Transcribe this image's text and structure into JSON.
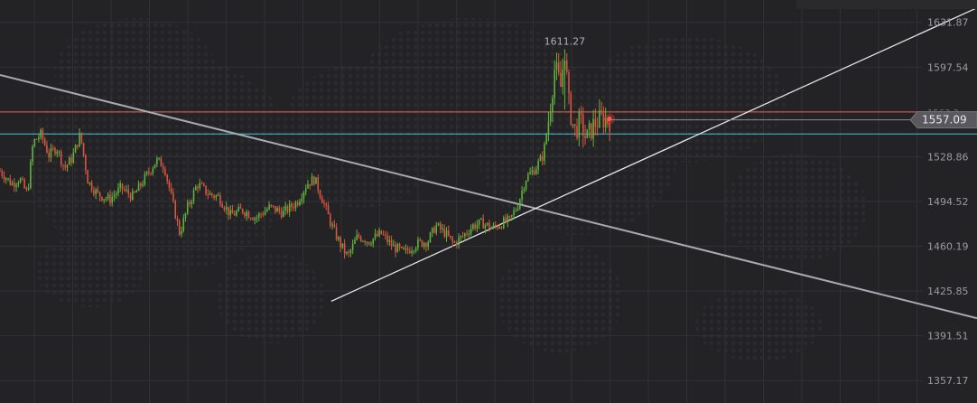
{
  "chart_data": {
    "type": "candlestick",
    "ylim": [
      1340.0,
      1649.0
    ],
    "y_ticks": [
      "1631.87",
      "1597.54",
      "1563.2",
      "1528.86",
      "1494.52",
      "1460.19",
      "1425.85",
      "1391.51",
      "1357.17"
    ],
    "last_price": "1557.09",
    "high_marker": "1611.27",
    "horizontal_levels": [
      {
        "value": 1563.2,
        "color": "#d9694f"
      },
      {
        "value": 1546.3,
        "color": "#46c2d4"
      }
    ],
    "trendlines": [
      {
        "name": "descending",
        "from": [
          0,
          1591.5
        ],
        "to": [
          1.0,
          1405.0
        ],
        "color": "#a9a9b1"
      },
      {
        "name": "ascending",
        "from": [
          0.339,
          1418.0
        ],
        "to": [
          1.0,
          1643.0
        ],
        "color": "#e6e6ea"
      }
    ],
    "up_color": "#5fb33c",
    "down_color": "#d9553f",
    "close_path": [
      [
        0.0,
        1518
      ],
      [
        0.012,
        1508
      ],
      [
        0.02,
        1512
      ],
      [
        0.028,
        1500
      ],
      [
        0.034,
        1540
      ],
      [
        0.042,
        1546
      ],
      [
        0.05,
        1530
      ],
      [
        0.058,
        1536
      ],
      [
        0.066,
        1520
      ],
      [
        0.074,
        1528
      ],
      [
        0.082,
        1546
      ],
      [
        0.09,
        1510
      ],
      [
        0.1,
        1500
      ],
      [
        0.112,
        1496
      ],
      [
        0.124,
        1505
      ],
      [
        0.136,
        1498
      ],
      [
        0.148,
        1512
      ],
      [
        0.16,
        1526
      ],
      [
        0.168,
        1522
      ],
      [
        0.176,
        1496
      ],
      [
        0.184,
        1470
      ],
      [
        0.192,
        1490
      ],
      [
        0.202,
        1508
      ],
      [
        0.214,
        1500
      ],
      [
        0.224,
        1498
      ],
      [
        0.236,
        1484
      ],
      [
        0.248,
        1488
      ],
      [
        0.262,
        1482
      ],
      [
        0.276,
        1490
      ],
      [
        0.29,
        1486
      ],
      [
        0.304,
        1494
      ],
      [
        0.314,
        1508
      ],
      [
        0.322,
        1512
      ],
      [
        0.33,
        1496
      ],
      [
        0.34,
        1475
      ],
      [
        0.348,
        1462
      ],
      [
        0.356,
        1452
      ],
      [
        0.366,
        1468
      ],
      [
        0.378,
        1464
      ],
      [
        0.39,
        1470
      ],
      [
        0.402,
        1460
      ],
      [
        0.414,
        1455
      ],
      [
        0.426,
        1462
      ],
      [
        0.438,
        1464
      ],
      [
        0.446,
        1476
      ],
      [
        0.456,
        1470
      ],
      [
        0.464,
        1462
      ],
      [
        0.474,
        1468
      ],
      [
        0.484,
        1476
      ],
      [
        0.494,
        1478
      ],
      [
        0.504,
        1474
      ],
      [
        0.514,
        1478
      ],
      [
        0.522,
        1480
      ],
      [
        0.53,
        1492
      ],
      [
        0.538,
        1512
      ],
      [
        0.548,
        1520
      ],
      [
        0.556,
        1530
      ],
      [
        0.562,
        1560
      ],
      [
        0.568,
        1598
      ],
      [
        0.574,
        1582
      ],
      [
        0.578,
        1611
      ],
      [
        0.582,
        1570
      ],
      [
        0.588,
        1548
      ],
      [
        0.594,
        1556
      ],
      [
        0.6,
        1542
      ],
      [
        0.608,
        1554
      ],
      [
        0.616,
        1558
      ],
      [
        0.624,
        1557
      ]
    ],
    "n_candles": 300
  }
}
